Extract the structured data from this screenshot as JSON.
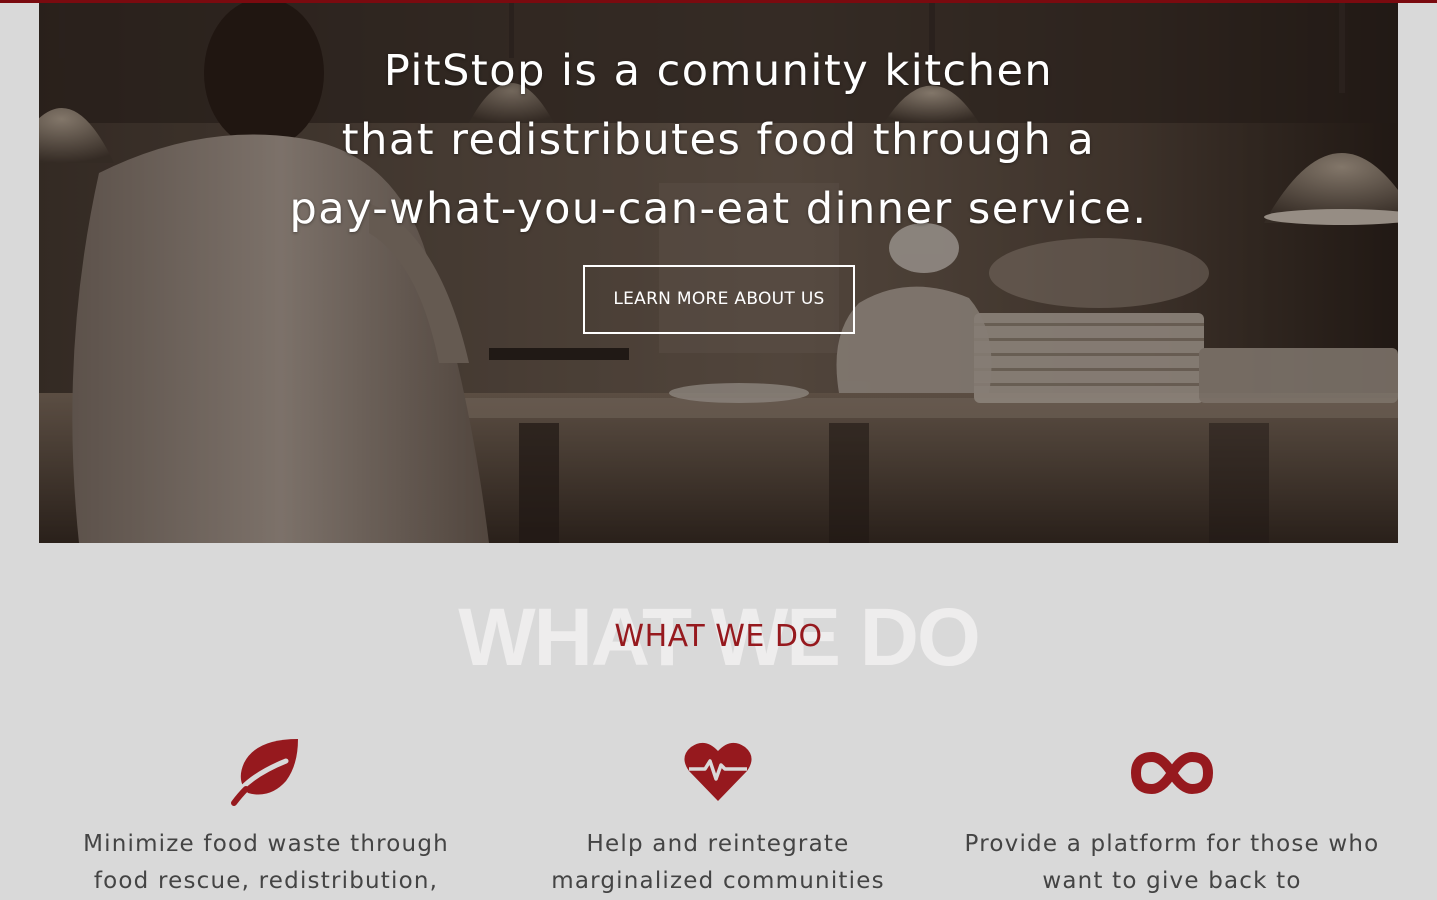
{
  "hero": {
    "title_lines": [
      "PitStop is a comunity kitchen",
      "that redistributes food through a",
      "pay-what-you-can-eat dinner service."
    ],
    "button_label": "LEARN MORE ABOUT US"
  },
  "what_we_do": {
    "ghost_text": "WHAT WE DO",
    "heading": "WHAT WE DO"
  },
  "features": [
    {
      "icon": "leaf-icon",
      "text": "Minimize food waste through food rescue, redistribution,"
    },
    {
      "icon": "heartbeat-icon",
      "text": "Help and reintegrate marginalized communities"
    },
    {
      "icon": "infinity-icon",
      "text": "Provide a platform for those who want to give back to"
    }
  ],
  "colors": {
    "accent": "#96191e",
    "page_background": "#d9d9d9",
    "text": "#444444"
  }
}
